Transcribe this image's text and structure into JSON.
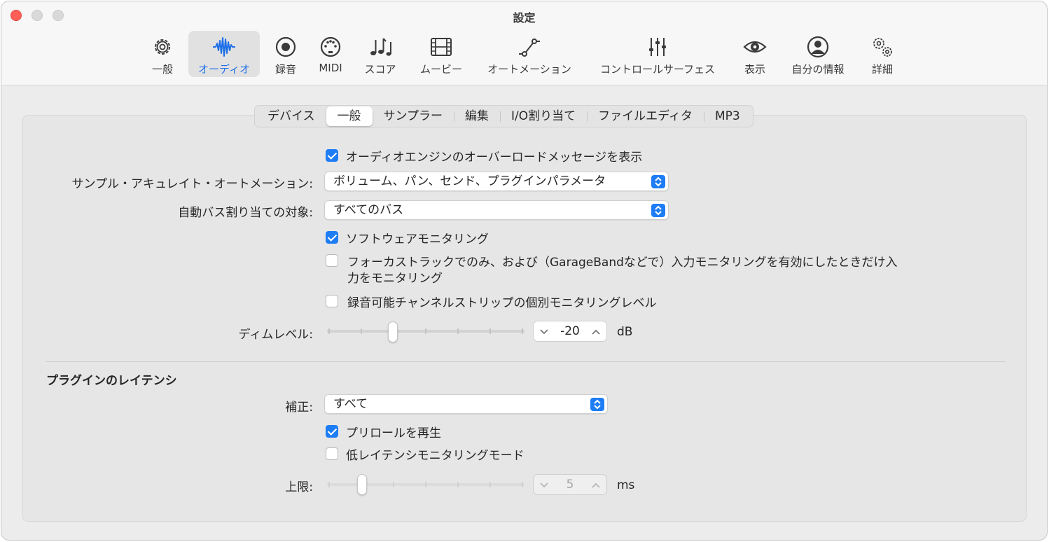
{
  "window": {
    "title": "設定"
  },
  "toolbar": {
    "items": [
      {
        "label": "一般",
        "icon": "gear-icon"
      },
      {
        "label": "オーディオ",
        "icon": "waveform-icon",
        "active": true
      },
      {
        "label": "録音",
        "icon": "record-icon"
      },
      {
        "label": "MIDI",
        "icon": "midi-port-icon"
      },
      {
        "label": "スコア",
        "icon": "music-notes-icon"
      },
      {
        "label": "ムービー",
        "icon": "film-icon"
      },
      {
        "label": "オートメーション",
        "icon": "automation-curve-icon"
      },
      {
        "label": "コントロールサーフェス",
        "icon": "sliders-icon"
      },
      {
        "label": "表示",
        "icon": "eye-icon"
      },
      {
        "label": "自分の情報",
        "icon": "person-icon"
      },
      {
        "label": "詳細",
        "icon": "gears-icon"
      }
    ]
  },
  "tabs": [
    "デバイス",
    "一般",
    "サンプラー",
    "編集",
    "I/O割り当て",
    "ファイルエディタ",
    "MP3"
  ],
  "active_tab": "一般",
  "general": {
    "overload_message": {
      "label": "オーディオエンジンのオーバーロードメッセージを表示",
      "checked": true
    },
    "sample_accurate": {
      "label": "サンプル・アキュレイト・オートメーション:",
      "value": "ボリューム、パン、センド、プラグインパラメータ"
    },
    "auto_bus": {
      "label": "自動バス割り当ての対象:",
      "value": "すべてのバス"
    },
    "software_monitoring": {
      "label": "ソフトウェアモニタリング",
      "checked": true
    },
    "focus_monitoring": {
      "line1": "フォーカストラックでのみ、および（GarageBandなどで）入力モニタリングを有効にしたときだけ入",
      "line2": "力をモニタリング",
      "checked": false
    },
    "individual_level": {
      "label": "録音可能チャンネルストリップの個別モニタリングレベル",
      "checked": false
    },
    "dim_level": {
      "label": "ディムレベル:",
      "value": "-20",
      "unit": "dB",
      "slider_fraction": 0.34
    }
  },
  "latency": {
    "title": "プラグインのレイテンシ",
    "compensation": {
      "label": "補正:",
      "value": "すべて"
    },
    "preroll": {
      "label": "プリロールを再生",
      "checked": true
    },
    "low_latency": {
      "label": "低レイテンシモニタリングモード",
      "checked": false
    },
    "limit": {
      "label": "上限:",
      "value": "5",
      "unit": "ms",
      "slider_fraction": 0.18
    }
  },
  "colors": {
    "accent": "#1e7df5",
    "active_label": "#1e6fe8",
    "close": "#ff5f57"
  }
}
